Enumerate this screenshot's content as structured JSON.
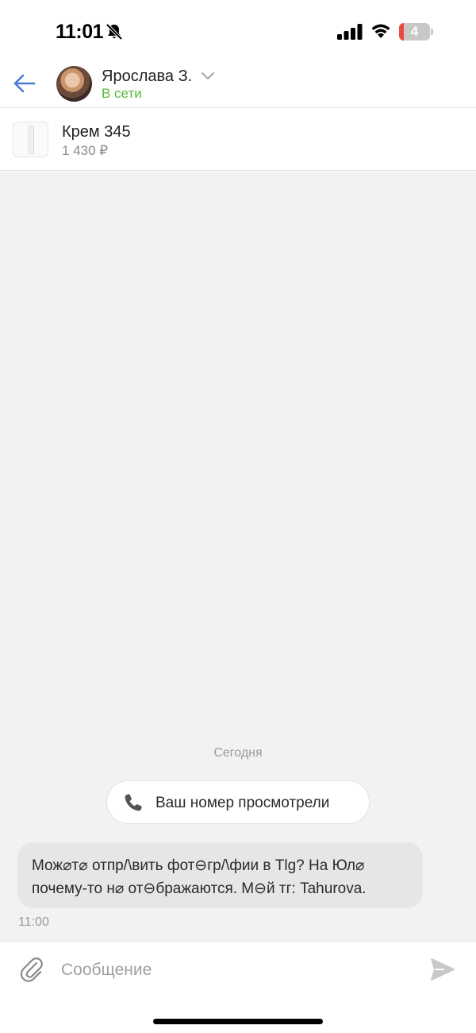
{
  "status_bar": {
    "time": "11:01",
    "battery_level": "4",
    "icons": [
      "bell-slash-icon",
      "signal-icon",
      "wifi-icon",
      "battery-icon"
    ]
  },
  "header": {
    "contact_name": "Ярослава З.",
    "status": "В сети",
    "icons": [
      "back-arrow-icon",
      "chevron-down-icon"
    ]
  },
  "product": {
    "title": "Крем 345",
    "price": "1 430 ₽"
  },
  "chat": {
    "date_separator": "Сегодня",
    "system_message": "Ваш номер просмотрели",
    "messages": [
      {
        "text": "Мож⌀т⌀ отпр/\\вить фот⊖гр/\\фии в Tlg? На Юл⌀ почему-то н⌀ от⊖бражаются. М⊖й тг: Tahurova.",
        "time": "11:00"
      }
    ]
  },
  "composer": {
    "placeholder": "Сообщение",
    "icons": [
      "paperclip-icon",
      "send-icon"
    ]
  },
  "colors": {
    "accent_blue": "#4a7bd8",
    "online_green": "#5bb83a",
    "chat_background": "#f2f2f5",
    "bubble_background": "#e6e6e9"
  }
}
